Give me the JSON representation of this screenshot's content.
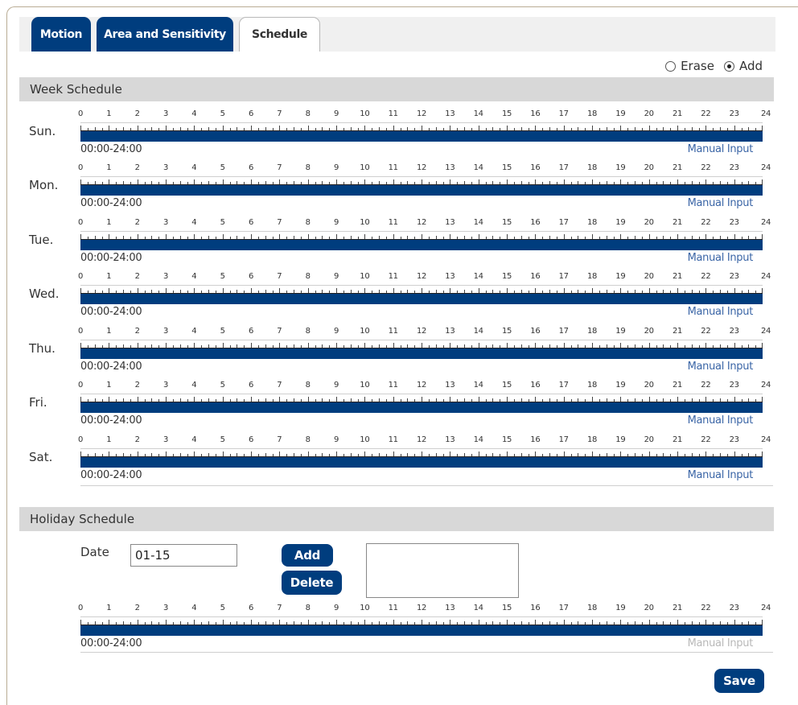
{
  "tabs": [
    {
      "label": "Motion",
      "active": false
    },
    {
      "label": "Area and Sensitivity",
      "active": false
    },
    {
      "label": "Schedule",
      "active": true
    }
  ],
  "mode": {
    "erase_label": "Erase",
    "add_label": "Add",
    "selected": "Add"
  },
  "week_schedule": {
    "title": "Week Schedule",
    "hour_labels": [
      "0",
      "1",
      "2",
      "3",
      "4",
      "5",
      "6",
      "7",
      "8",
      "9",
      "10",
      "11",
      "12",
      "13",
      "14",
      "15",
      "16",
      "17",
      "18",
      "19",
      "20",
      "21",
      "22",
      "23",
      "24"
    ],
    "days": [
      {
        "label": "Sun.",
        "range": "00:00-24:00",
        "manual_input": "Manual Input"
      },
      {
        "label": "Mon.",
        "range": "00:00-24:00",
        "manual_input": "Manual Input"
      },
      {
        "label": "Tue.",
        "range": "00:00-24:00",
        "manual_input": "Manual Input"
      },
      {
        "label": "Wed.",
        "range": "00:00-24:00",
        "manual_input": "Manual Input"
      },
      {
        "label": "Thu.",
        "range": "00:00-24:00",
        "manual_input": "Manual Input"
      },
      {
        "label": "Fri.",
        "range": "00:00-24:00",
        "manual_input": "Manual Input"
      },
      {
        "label": "Sat.",
        "range": "00:00-24:00",
        "manual_input": "Manual Input"
      }
    ]
  },
  "holiday_schedule": {
    "title": "Holiday Schedule",
    "date_label": "Date",
    "date_value": "01-15",
    "add_label": "Add",
    "delete_label": "Delete",
    "range": "00:00-24:00",
    "manual_input": "Manual Input"
  },
  "save_label": "Save",
  "colors": {
    "accent": "#003d7e",
    "link": "#3a65a6",
    "section_bar": "#d8d8d8"
  }
}
